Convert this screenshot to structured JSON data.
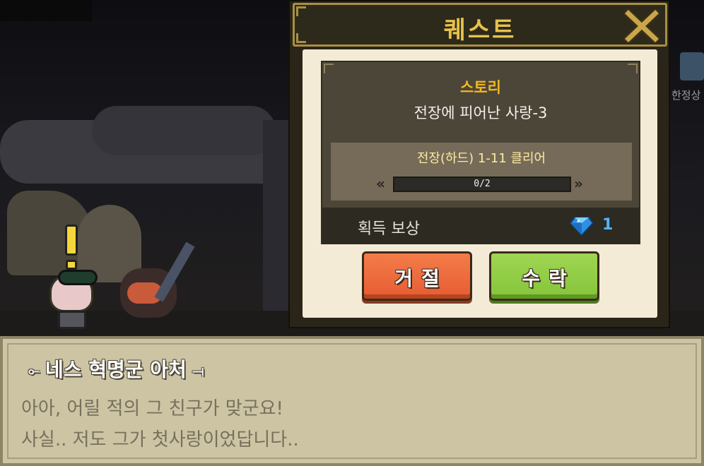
{
  "scene": {
    "right_icon_label": "한정상"
  },
  "quest": {
    "title": "퀘스트",
    "category": "스토리",
    "name": "전장에 피어난 사랑-3",
    "objective": "전장(하드) 1-11 클리어",
    "progress": {
      "current": 0,
      "total": 2,
      "text": "0/2"
    },
    "reward_label": "획득 보상",
    "reward_icon": "diamond-gem-icon",
    "reward_count": "1",
    "reject_label": "거절",
    "accept_label": "수락",
    "close_icon": "close-x-icon"
  },
  "dialog": {
    "speaker": "네스 혁명군 아처",
    "line1": "아아, 어릴 적의 그 친구가 맞군요!",
    "line2": "사실.. 저도 그가 첫사랑이었답니다.."
  },
  "colors": {
    "title_gold": "#e7c24b",
    "story_orange": "#f2b81f",
    "reject_orange": "#e65c32",
    "accept_green": "#85c43a",
    "reward_blue": "#56b4ff"
  }
}
